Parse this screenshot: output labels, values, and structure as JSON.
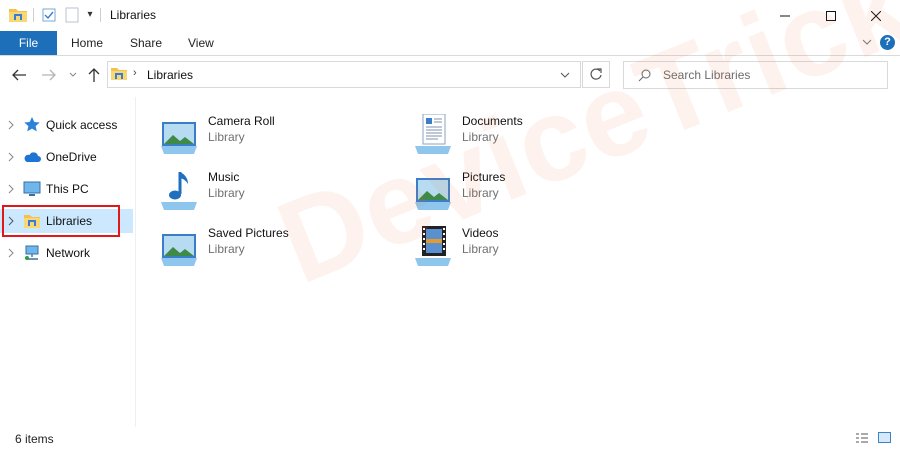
{
  "window": {
    "title": "Libraries"
  },
  "ribbon": {
    "tabs": {
      "file": "File",
      "home": "Home",
      "share": "Share",
      "view": "View"
    },
    "help": "?"
  },
  "address_bar": {
    "location": "Libraries"
  },
  "search": {
    "placeholder": "Search Libraries",
    "value": ""
  },
  "sidebar": {
    "items": [
      {
        "label": "Quick access",
        "icon": "star-icon"
      },
      {
        "label": "OneDrive",
        "icon": "cloud-icon"
      },
      {
        "label": "This PC",
        "icon": "computer-icon"
      },
      {
        "label": "Libraries",
        "icon": "libraries-folder-icon",
        "selected": true
      },
      {
        "label": "Network",
        "icon": "network-icon"
      }
    ]
  },
  "libraries": [
    {
      "name": "Camera Roll",
      "type": "Library",
      "icon": "picture-library-icon"
    },
    {
      "name": "Documents",
      "type": "Library",
      "icon": "documents-library-icon"
    },
    {
      "name": "Music",
      "type": "Library",
      "icon": "music-library-icon"
    },
    {
      "name": "Pictures",
      "type": "Library",
      "icon": "picture-library-icon"
    },
    {
      "name": "Saved Pictures",
      "type": "Library",
      "icon": "picture-library-icon"
    },
    {
      "name": "Videos",
      "type": "Library",
      "icon": "videos-library-icon"
    }
  ],
  "status_bar": {
    "item_count": "6 items"
  },
  "watermark": "DeviceTricks",
  "colors": {
    "accent": "#1d6fba",
    "selection": "#cce8ff",
    "highlight_box": "#e01818"
  }
}
